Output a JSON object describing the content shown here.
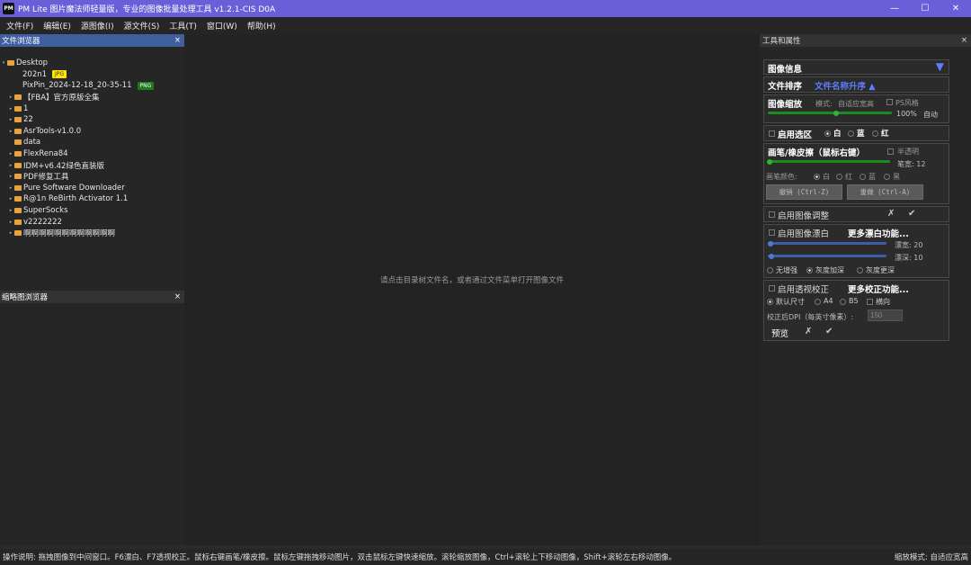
{
  "app": {
    "icon": "PM",
    "title": "PM Lite 图片魔法师轻量版，专业的图像批量处理工具 v1.2.1-CIS D0A"
  },
  "window_controls": {
    "minimize": "—",
    "maximize": "☐",
    "close": "✕"
  },
  "menu": [
    "文件(F)",
    "编辑(E)",
    "源图像(I)",
    "源文件(S)",
    "工具(T)",
    "窗口(W)",
    "帮助(H)"
  ],
  "file_browser": {
    "title": "文件浏览器",
    "close": "×",
    "root": "Desktop",
    "files": [
      {
        "name": "202n1",
        "tag": "JPG"
      },
      {
        "name": "PixPin_2024-12-18_20-35-11",
        "tag": "PNG"
      }
    ],
    "folders": [
      "【FBA】官方原版全集",
      "1",
      "22",
      "AsrTools-v1.0.0",
      "data",
      "FlexRena84",
      "IDM+v6.42绿色直装版",
      "PDF修复工具",
      "Pure Software Downloader",
      "R@1n ReBirth Activator 1.1",
      "SuperSocks",
      "v2222222",
      "啊啊啊啊啊啊啊啊啊啊啊啊"
    ]
  },
  "thumb_browser": {
    "title": "缩略图浏览器",
    "close": "×"
  },
  "center": {
    "hint": "请点击目录树文件名，或者通过文件菜单打开图像文件"
  },
  "tools": {
    "title": "工具和属性",
    "close": "×",
    "image_info": {
      "label": "图像信息",
      "arrow": "▼"
    },
    "sort": {
      "label": "文件排序",
      "value": "文件名称升序 ▲"
    },
    "zoom": {
      "label": "图像缩放",
      "mode_label": "模式:",
      "mode": "自适应宽高",
      "ps_style": "PS风格",
      "percent": "100%",
      "auto": "自动",
      "level": 0.55
    },
    "selection": {
      "label": "启用选区",
      "options": [
        "白",
        "蓝",
        "红"
      ]
    },
    "brush": {
      "label": "画笔/橡皮擦（鼠标右键）",
      "semi": "半透明",
      "width_label": "笔宽: 12",
      "color_label": "画笔颜色:",
      "colors": [
        "白",
        "红",
        "蓝",
        "黑"
      ],
      "undo": "撤销 (Ctrl-Z)",
      "redo": "重做 (Ctrl-A)"
    },
    "adjust": {
      "label": "启用图像调整",
      "cancel": "✗",
      "ok": "✔"
    },
    "whiten": {
      "label": "启用图像漂白",
      "more": "更多漂白功能...",
      "width_label": "漂宽: 20",
      "depth_label": "漂深: 10",
      "modes": [
        "无增强",
        "灰度加深",
        "灰度更深"
      ]
    },
    "perspective": {
      "label": "启用透视校正",
      "more": "更多校正功能...",
      "sizes": [
        "默认尺寸",
        "A4",
        "B5"
      ],
      "landscape": "横向",
      "dpi_label": "校正后DPI（每英寸像素）:",
      "dpi_value": "150",
      "preview": "预览",
      "cancel": "✗",
      "ok": "✔"
    }
  },
  "status": {
    "help": "操作说明: 拖拽图像到中间窗口。F6漂白、F7透视校正。鼠标右键画笔/橡皮擦。鼠标左键拖拽移动图片，双击鼠标左键快速缩放。滚轮缩放图像，Ctrl+滚轮上下移动图像，Shift+滚轮左右移动图像。",
    "zoom_mode": "缩放模式: 自适应宽高"
  }
}
